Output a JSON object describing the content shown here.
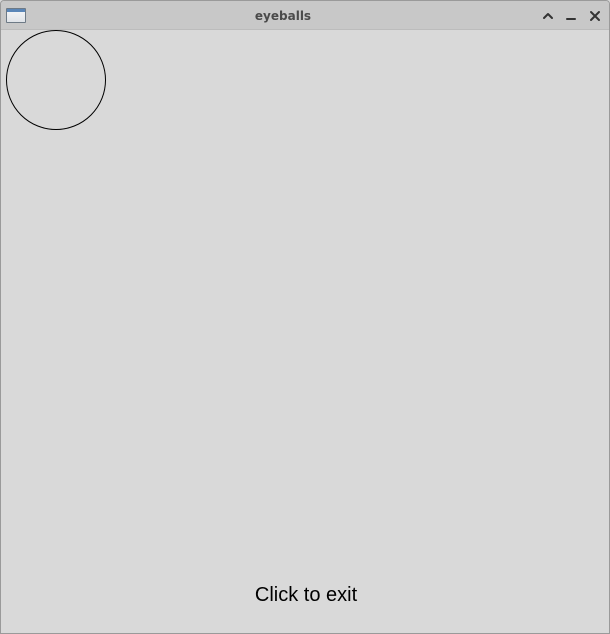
{
  "window": {
    "title": "eyeballs",
    "icon": "application-window-icon",
    "controls": [
      "shade-up-icon",
      "minimize-icon",
      "close-icon"
    ]
  },
  "canvas": {
    "message": "Click to exit",
    "shapes": [
      "circle"
    ]
  },
  "colors": {
    "titlebar": "#c8c8c8",
    "background": "#d9d9d9",
    "stroke": "#000000"
  }
}
